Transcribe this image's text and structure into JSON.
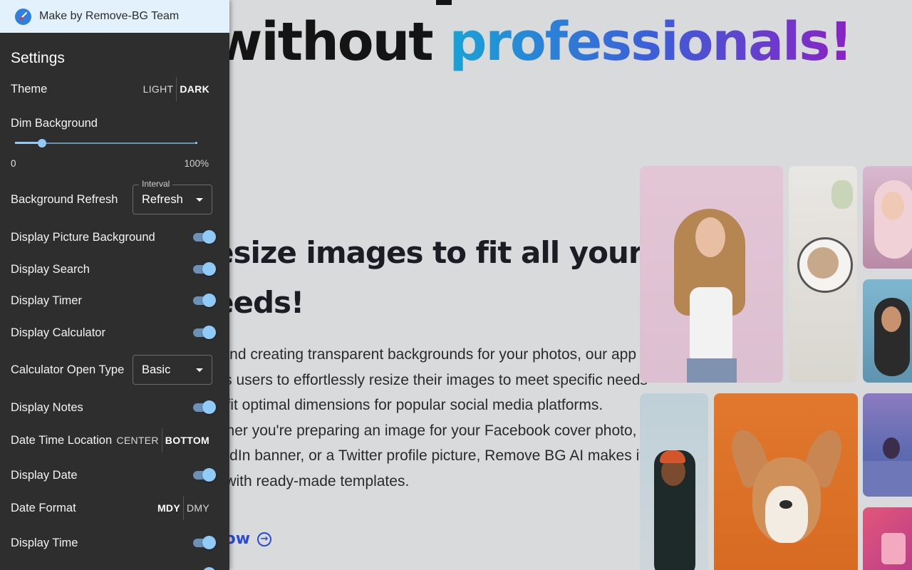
{
  "background": {
    "hero_title_plain": "without ",
    "hero_title_accent": "professionals!",
    "sub_heading_lines": [
      "esize images to fit all your",
      "eeds!"
    ],
    "paragraph_lines": [
      "yond creating transparent backgrounds for your photos, our app",
      "ws users to effortlessly resize their images to meet specific needs",
      "o fit optimal dimensions for popular social media platforms.",
      "ether you're preparing an image for your Facebook cover photo,",
      "kedIn banner, or a Twitter profile picture, Remove BG AI makes it",
      "y with ready-made templates."
    ],
    "cta_label": "now",
    "accent_colors": [
      "#19a3d6",
      "#3c5fd8",
      "#8a22c4"
    ]
  },
  "panel": {
    "header_text": "Make by Remove-BG Team",
    "header_icon": "paintbrush-icon",
    "title": "Settings",
    "theme": {
      "label": "Theme",
      "options": [
        "LIGHT",
        "DARK"
      ],
      "selected": "DARK"
    },
    "dim_background": {
      "label": "Dim Background",
      "min_label": "0",
      "max_label": "100%",
      "value_percent": 15
    },
    "background_refresh": {
      "label": "Background Refresh",
      "legend": "Interval",
      "value": "Refresh"
    },
    "display_picture_background": {
      "label": "Display Picture Background",
      "on": true
    },
    "display_search": {
      "label": "Display Search",
      "on": true
    },
    "display_timer": {
      "label": "Display Timer",
      "on": true
    },
    "display_calculator": {
      "label": "Display Calculator",
      "on": true
    },
    "calculator_open_type": {
      "label": "Calculator Open Type",
      "value": "Basic"
    },
    "display_notes": {
      "label": "Display Notes",
      "on": true
    },
    "date_time_location": {
      "label": "Date Time Location",
      "options": [
        "CENTER",
        "BOTTOM"
      ],
      "selected": "BOTTOM"
    },
    "display_date": {
      "label": "Display Date",
      "on": true
    },
    "date_format": {
      "label": "Date Format",
      "options": [
        "MDY",
        "DMY"
      ],
      "selected": "MDY"
    },
    "display_time": {
      "label": "Display Time",
      "on": true
    },
    "toggle_color": "#90caf9"
  }
}
